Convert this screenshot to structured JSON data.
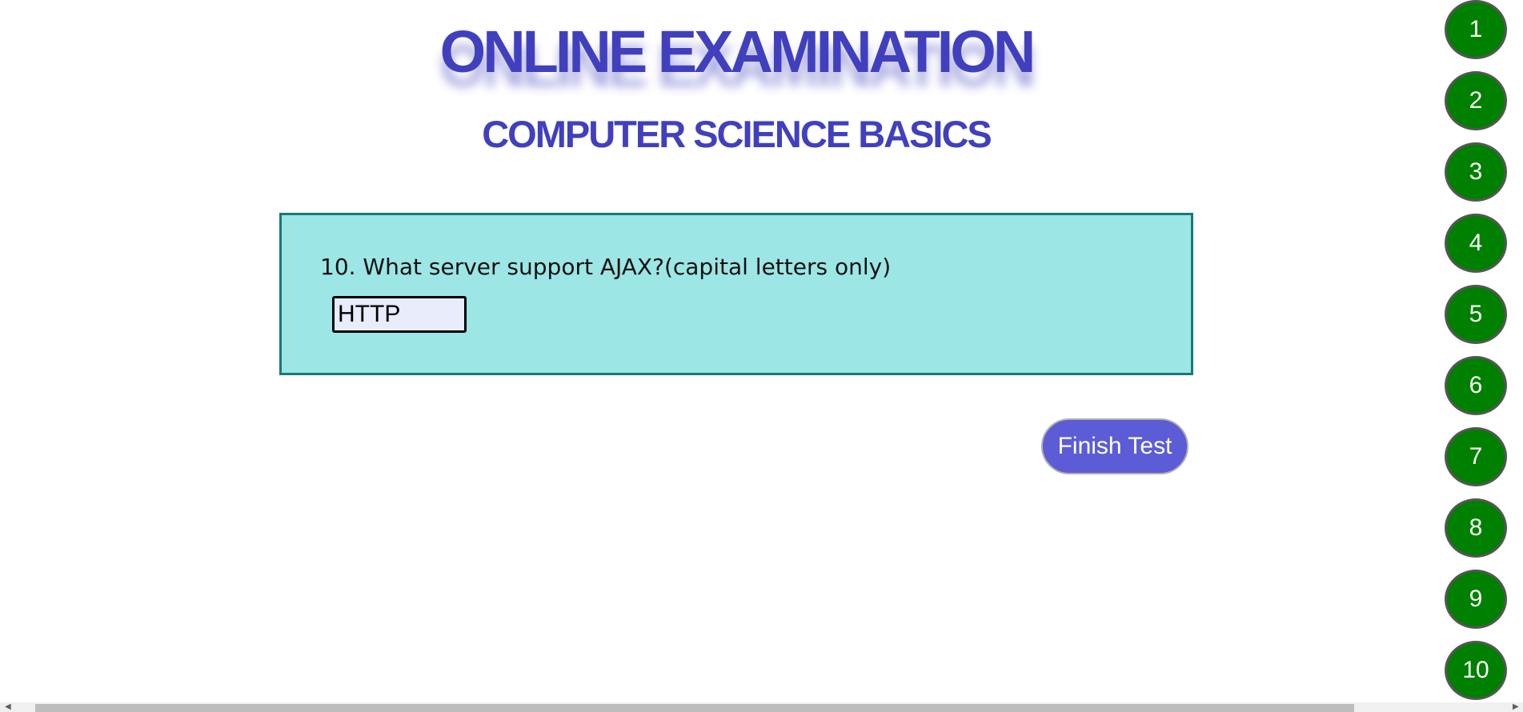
{
  "header": {
    "title": "ONLINE EXAMINATION",
    "subtitle": "COMPUTER SCIENCE BASICS"
  },
  "question": {
    "text": "10. What server support AJAX?(capital letters only)",
    "answer_value": "HTTP"
  },
  "actions": {
    "finish_label": "Finish Test"
  },
  "question_nav": [
    "1",
    "2",
    "3",
    "4",
    "5",
    "6",
    "7",
    "8",
    "9",
    "10"
  ],
  "colors": {
    "title": "#4040bf",
    "question_bg": "#9ce6e6",
    "finish_button": "#5c5cd6",
    "nav_button": "#008000"
  },
  "icons": {
    "scroll_left": "◀",
    "scroll_right": "▶"
  }
}
